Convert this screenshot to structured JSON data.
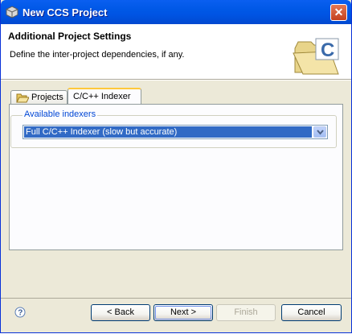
{
  "window": {
    "title": "New CCS Project",
    "icon": "ccs-project-icon",
    "close_icon": "close-icon"
  },
  "header": {
    "title": "Additional Project Settings",
    "description": "Define the inter-project dependencies, if any.",
    "banner_icon": "c-project-folder-icon"
  },
  "tabs": [
    {
      "label": "Projects",
      "icon": "folder-open-icon",
      "selected": false
    },
    {
      "label": "C/C++ Indexer",
      "selected": true
    }
  ],
  "indexer": {
    "group_label": "Available indexers",
    "selected_value": "Full C/C++ Indexer (slow but accurate)"
  },
  "footer": {
    "help_icon": "help-icon",
    "back_label": "< Back",
    "next_label": "Next >",
    "finish_label": "Finish",
    "cancel_label": "Cancel"
  },
  "colors": {
    "titlebar": "#0054e3",
    "selection": "#316ac5",
    "group_label": "#0046d5",
    "tab_highlight": "#ffc83c"
  }
}
